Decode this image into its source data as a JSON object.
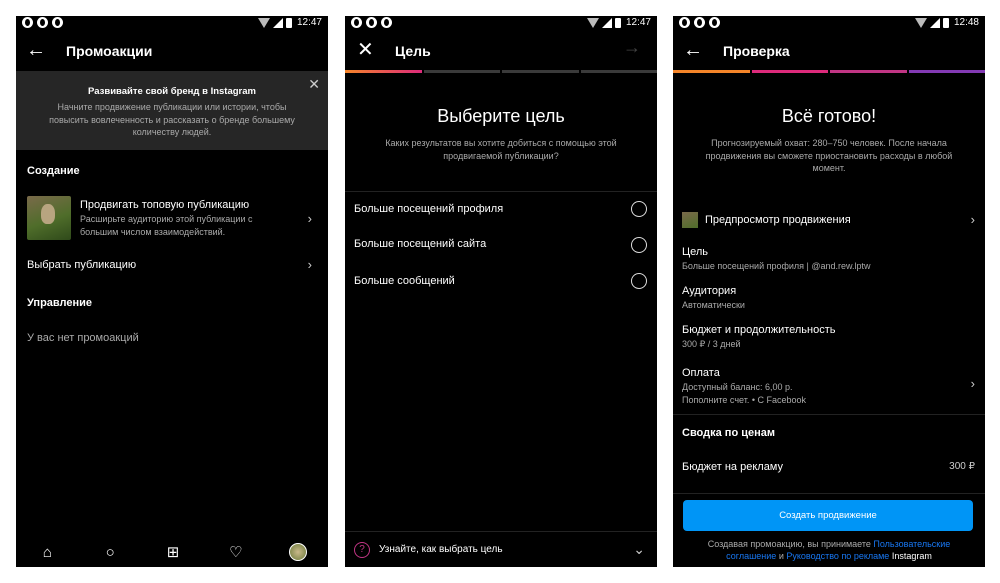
{
  "screen1": {
    "status": {
      "time": "12:47"
    },
    "header": {
      "title": "Промоакции"
    },
    "banner": {
      "title": "Развивайте свой бренд в Instagram",
      "text": "Начните продвижение публикации или истории, чтобы повысить вовлеченность и рассказать о бренде большему количеству людей."
    },
    "creation": {
      "heading": "Создание",
      "top_post_title": "Продвигать топовую публикацию",
      "top_post_sub": "Расширьте аудиторию этой публикации с большим числом взаимодействий.",
      "choose_post": "Выбрать публикацию"
    },
    "management": {
      "heading": "Управление",
      "empty": "У вас нет промоакций"
    },
    "nav": [
      "home-icon",
      "search-icon",
      "add-post-icon",
      "heart-icon",
      "profile-avatar"
    ]
  },
  "screen2": {
    "status": {
      "time": "12:47"
    },
    "header": {
      "title": "Цель"
    },
    "heading": "Выберите цель",
    "subheading": "Каких результатов вы хотите добиться с помощью этой продвигаемой публикации?",
    "options": [
      {
        "label": "Больше посещений профиля"
      },
      {
        "label": "Больше посещений сайта"
      },
      {
        "label": "Больше сообщений"
      }
    ],
    "help": "Узнайте, как выбрать цель"
  },
  "screen3": {
    "status": {
      "time": "12:48"
    },
    "header": {
      "title": "Проверка"
    },
    "heading": "Всё готово!",
    "subheading": "Прогнозируемый охват: 280–750 человек. После начала продвижения вы сможете приостановить расходы в любой момент.",
    "preview": "Предпросмотр продвижения",
    "goal": {
      "label": "Цель",
      "value": "Больше посещений профиля | @and.rew.lptw"
    },
    "audience": {
      "label": "Аудитория",
      "value": "Автоматически"
    },
    "budget": {
      "label": "Бюджет и продолжительность",
      "value": "300 ₽ / 3 дней"
    },
    "payment": {
      "label": "Оплата",
      "line1": "Доступный баланс: 6,00 р.",
      "line2": "Пополните счет. • С Facebook"
    },
    "summary": {
      "heading": "Сводка по ценам",
      "ad_budget_label": "Бюджет на рекламу",
      "ad_budget_value": "300 ₽"
    },
    "create_button": "Создать продвижение",
    "terms": {
      "prefix": "Создавая промоакцию, вы принимаете ",
      "link1": "Пользовательские соглашение",
      "and": " и ",
      "link2": "Руководство по рекламе",
      "suffix": " Instagram"
    }
  }
}
